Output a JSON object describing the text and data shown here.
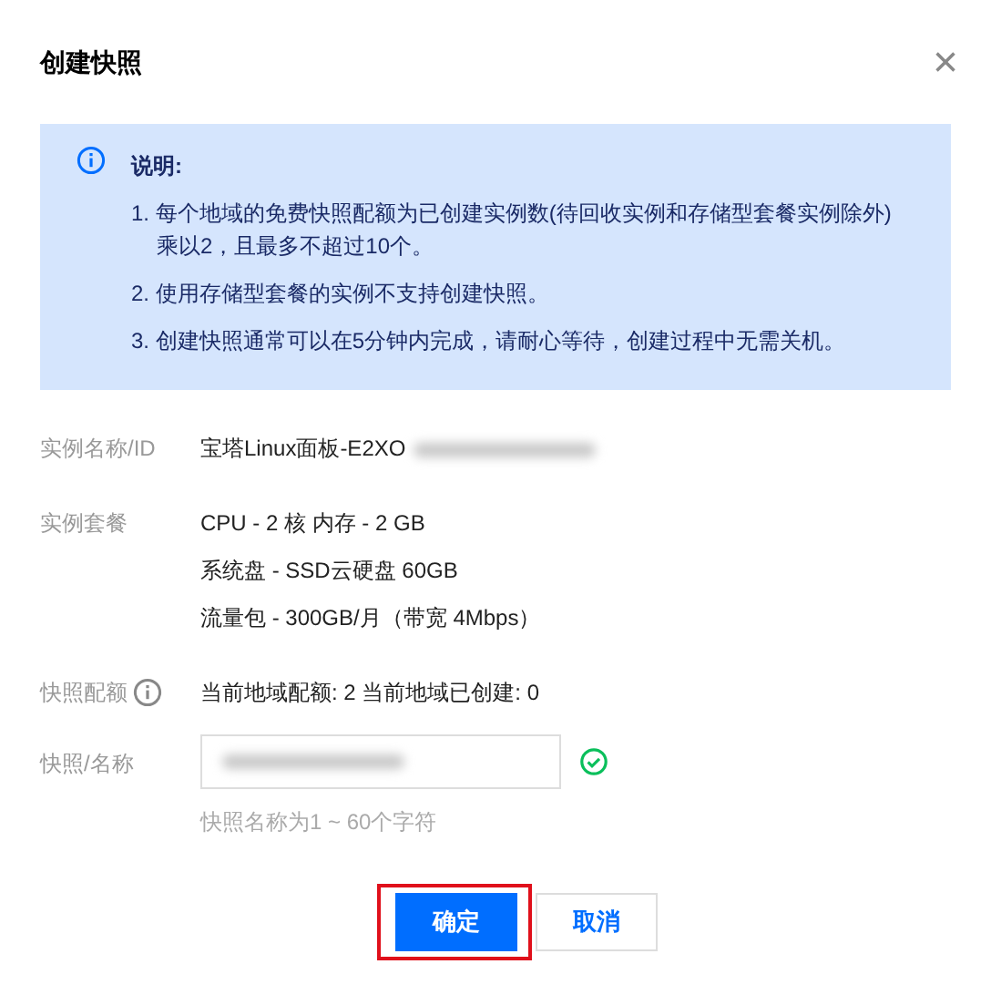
{
  "dialog": {
    "title": "创建快照",
    "close": "×"
  },
  "notice": {
    "heading": "说明:",
    "items": [
      "1. 每个地域的免费快照配额为已创建实例数(待回收实例和存储型套餐实例除外)乘以2，且最多不超过10个。",
      "2. 使用存储型套餐的实例不支持创建快照。",
      "3. 创建快照通常可以在5分钟内完成，请耐心等待，创建过程中无需关机。"
    ]
  },
  "fields": [
    {
      "kind": "text",
      "label": "实例名称/ID",
      "lines": [
        "宝塔Linux面板-E2XO"
      ],
      "redacted": true
    },
    {
      "kind": "text",
      "label": "实例套餐",
      "lines": [
        "CPU - 2 核 内存 - 2 GB",
        "系统盘 - SSD云硬盘 60GB",
        "流量包 - 300GB/月（带宽 4Mbps）"
      ],
      "redacted": false
    },
    {
      "kind": "quota",
      "label": "快照配额",
      "lines": [
        "当前地域配额: 2 当前地域已创建: 0"
      ],
      "redacted": false
    },
    {
      "kind": "input",
      "label": "快照/名称",
      "redacted": true,
      "valid": true,
      "hint": "快照名称为1 ~ 60个字符"
    }
  ],
  "buttons": [
    {
      "label": "确定",
      "primary": true,
      "highlighted": true
    },
    {
      "label": "取消",
      "primary": false,
      "highlighted": false
    }
  ]
}
